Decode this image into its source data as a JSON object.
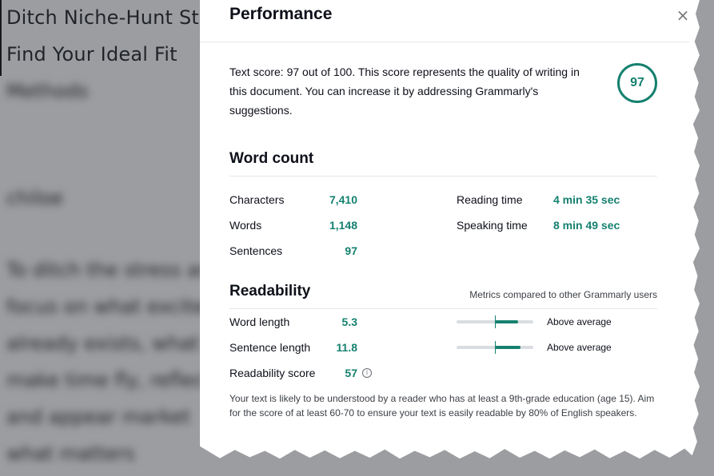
{
  "background": {
    "line1": "Ditch Niche-Hunt Str",
    "line2": "Find Your Ideal Fit",
    "blurred": [
      "Methods",
      "chiloe",
      "To ditch the stress ar",
      "focus on what excites",
      "already exists, what y",
      "make time fly, reflect",
      "and appear market",
      "what matters"
    ]
  },
  "modal": {
    "title": "Performance",
    "close_symbol": "×",
    "score_text": "Text score: 97 out of 100. This score represents the quality of writing in this document. You can increase it by addressing Grammarly's suggestions.",
    "score": "97",
    "word_count": {
      "title": "Word count",
      "left": [
        {
          "label": "Characters",
          "value": "7,410"
        },
        {
          "label": "Words",
          "value": "1,148"
        },
        {
          "label": "Sentences",
          "value": "97"
        }
      ],
      "right": [
        {
          "label": "Reading time",
          "value": "4 min 35 sec"
        },
        {
          "label": "Speaking time",
          "value": "8 min 49 sec"
        }
      ]
    },
    "readability": {
      "title": "Readability",
      "compare_note": "Metrics compared to other Grammarly users",
      "metrics": [
        {
          "label": "Word length",
          "value": "5.3",
          "status": "Above average",
          "bar_range": [
            0.5,
            0.8
          ]
        },
        {
          "label": "Sentence length",
          "value": "11.8",
          "status": "Above average",
          "bar_range": [
            0.5,
            0.83
          ]
        },
        {
          "label": "Readability score",
          "value": "57"
        }
      ],
      "info_symbol": "i",
      "note": "Your text is likely to be understood by a reader who has at least a 9th-grade education (age 15). Aim for the score of at least 60-70 to ensure your text is easily readable by 80% of English speakers."
    }
  },
  "colors": {
    "accent": "#15816f",
    "text": "#0e101a",
    "track": "#d9dce0"
  }
}
